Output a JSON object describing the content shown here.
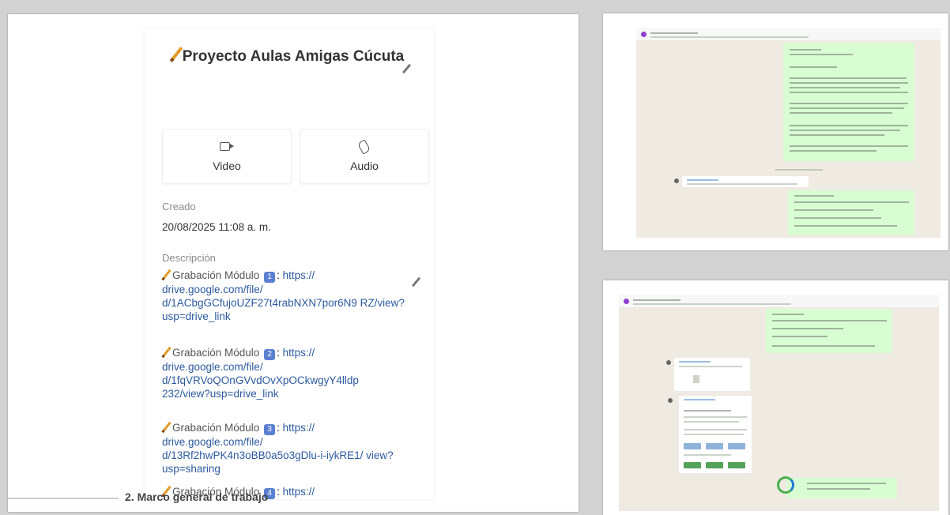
{
  "group": {
    "title": "Proyecto Aulas Amigas Cúcuta",
    "calls": [
      {
        "label": "Video",
        "icon": "video-camera-icon"
      },
      {
        "label": "Audio",
        "icon": "phone-icon"
      }
    ],
    "created_label": "Creado",
    "created_value": "20/08/2025 11:08 a. m.",
    "description_label": "Descripción",
    "descriptions": [
      {
        "prefix": "Grabación Módulo",
        "badge": "1",
        "link": "https:// drive.google.com/file/ d/1ACbgGCfujoUZF27t4rabNXN7por6N9 RZ/view?usp=drive_link"
      },
      {
        "prefix": "Grabación Módulo",
        "badge": "2",
        "link": "https:// drive.google.com/file/ d/1fqVRVoQOnGVvdOvXpOCkwgyY4lldp 232/view?usp=drive_link"
      },
      {
        "prefix": "Grabación Módulo",
        "badge": "3",
        "link": "https:// drive.google.com/file/ d/13Rf2hwPK4n3oBB0a5o3gDlu-i-iykRE1/ view?usp=sharing"
      },
      {
        "prefix": "Grabación Módulo",
        "badge": "4",
        "link": "https://"
      }
    ],
    "bottom_text": "2.  Marco general de trabajo"
  },
  "colors": {
    "link": "#2d5a9e",
    "chat_background": "#efeae2",
    "outgoing_bubble": "#d9fdd3",
    "group_avatar": "#8f3fd1"
  }
}
